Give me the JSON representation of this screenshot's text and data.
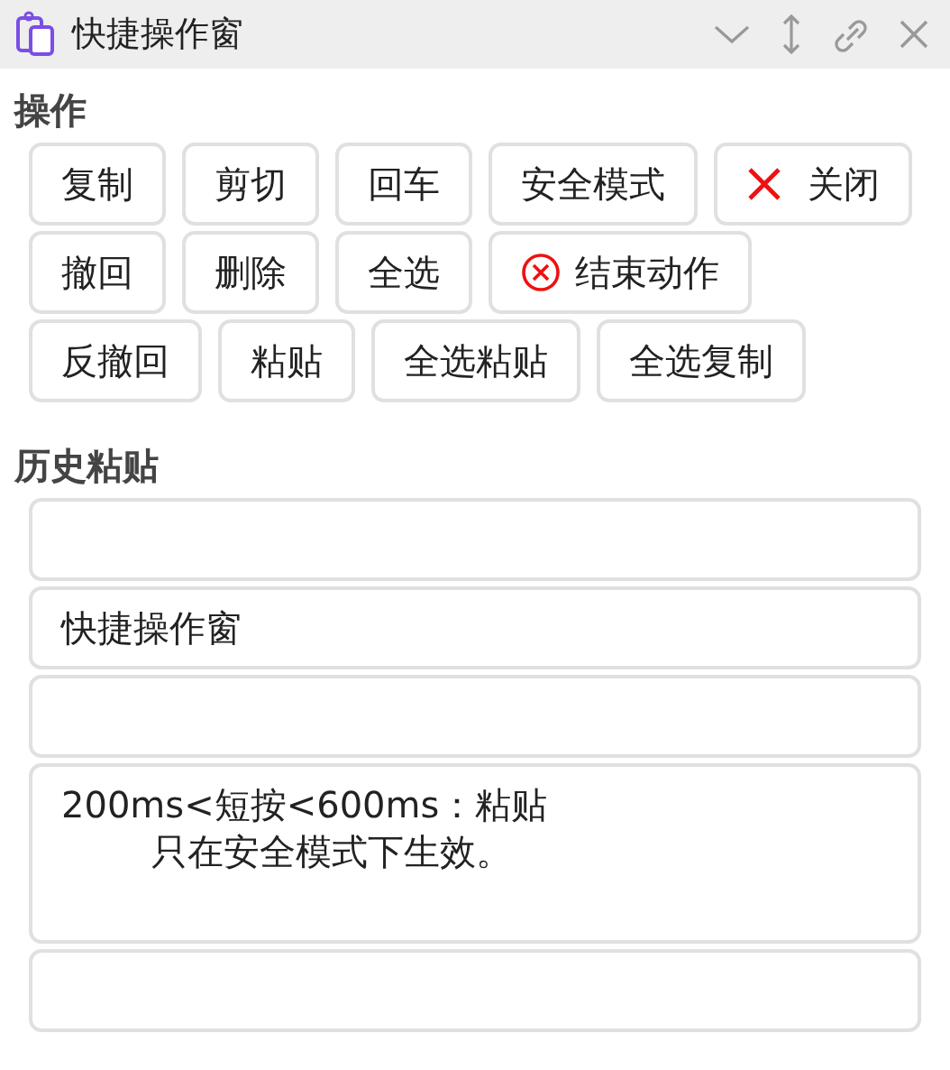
{
  "window": {
    "title": "快捷操作窗"
  },
  "actions": {
    "heading": "操作",
    "rows": [
      [
        {
          "label": "复制",
          "kind": "plain"
        },
        {
          "label": "剪切",
          "kind": "plain"
        },
        {
          "label": "回车",
          "kind": "plain"
        },
        {
          "label": "安全模式",
          "kind": "plain"
        },
        {
          "label": "关闭",
          "kind": "close"
        }
      ],
      [
        {
          "label": "撤回",
          "kind": "plain"
        },
        {
          "label": "删除",
          "kind": "plain"
        },
        {
          "label": "全选",
          "kind": "plain"
        },
        {
          "label": "结束动作",
          "kind": "stop"
        }
      ],
      [
        {
          "label": "反撤回",
          "kind": "plain"
        },
        {
          "label": "粘贴",
          "kind": "plain"
        },
        {
          "label": "全选粘贴",
          "kind": "plain"
        },
        {
          "label": "全选复制",
          "kind": "plain"
        }
      ]
    ]
  },
  "history": {
    "heading": "历史粘贴",
    "entries": [
      {
        "kind": "empty"
      },
      {
        "kind": "text",
        "lines": [
          "快捷操作窗"
        ]
      },
      {
        "kind": "empty"
      },
      {
        "kind": "text",
        "lines": [
          "200ms<短按<600ms：粘贴",
          "只在安全模式下生效。"
        ]
      },
      {
        "kind": "empty"
      }
    ]
  }
}
